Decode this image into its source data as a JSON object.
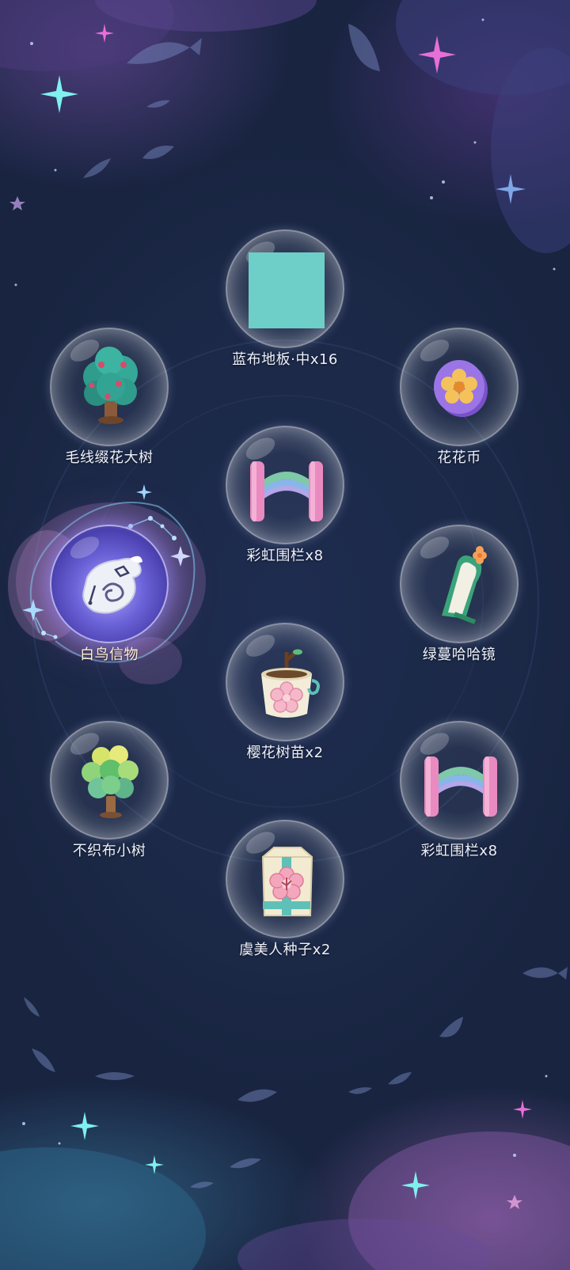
{
  "rewards": [
    {
      "id": "blue-cloth-floor",
      "label": "蓝布地板·中x16",
      "icon": "blue-floor-tile-icon"
    },
    {
      "id": "yarn-flower-tree",
      "label": "毛线缀花大树",
      "icon": "yarn-flower-tree-icon"
    },
    {
      "id": "flower-coin",
      "label": "花花币",
      "icon": "flower-coin-icon"
    },
    {
      "id": "rainbow-fence-1",
      "label": "彩虹围栏x8",
      "icon": "rainbow-fence-icon"
    },
    {
      "id": "white-bird-token",
      "label": "白鸟信物",
      "icon": "white-bird-token-icon",
      "selected": true
    },
    {
      "id": "green-vine-mirror",
      "label": "绿蔓哈哈镜",
      "icon": "green-vine-mirror-icon"
    },
    {
      "id": "sakura-sapling",
      "label": "樱花树苗x2",
      "icon": "sakura-sapling-icon"
    },
    {
      "id": "nonwoven-small-tree",
      "label": "不织布小树",
      "icon": "nonwoven-tree-icon"
    },
    {
      "id": "rainbow-fence-2",
      "label": "彩虹围栏x8",
      "icon": "rainbow-fence-icon"
    },
    {
      "id": "poppy-seed",
      "label": "虞美人种子x2",
      "icon": "poppy-seed-bag-icon"
    }
  ],
  "colors": {
    "background": "#1c2a4a",
    "floor_tile": "#6dcfc8",
    "label_text": "#eef1fb",
    "selected_glow": "#8f86ff"
  }
}
